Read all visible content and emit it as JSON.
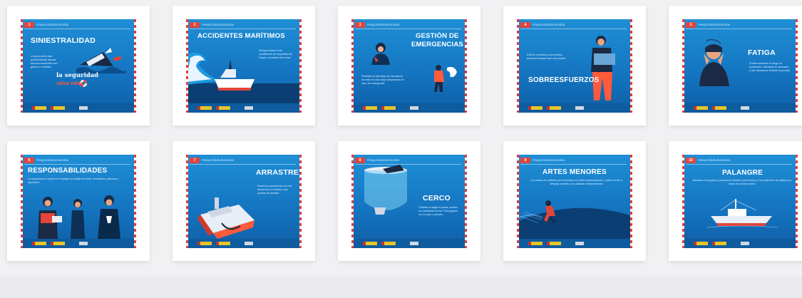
{
  "hashtag": "#seguridadsalvavidas",
  "colors": {
    "card_blue": "#1576c2",
    "badge_red": "#e2463b",
    "accent_orange": "#ff5a3a"
  },
  "cards": [
    {
      "number": "1",
      "title": "SINIESTRALIDAD",
      "description": "Lo pesca tiene alta accidentalidad laboral. Muchos accidentes son graves o mortales.",
      "extra_line1": "la seguridad",
      "extra_line2": "salva vidas"
    },
    {
      "number": "2",
      "title": "ACCIDENTES MARÍTIMOS",
      "description": "Siempre atento a las condiciones de seguridad del buque y al estado de la mar."
    },
    {
      "number": "3",
      "title_line1": "GESTIÓN DE",
      "title_line2": "EMERGENCIAS",
      "description": "Participa en ejercicios de simulacros sin éxito es una mejor preparación en caso de emergencia."
    },
    {
      "number": "4",
      "title": "SOBREESFUERZOS",
      "description": "Evita la maniobra y sus medios anclados siempre que sea posible."
    },
    {
      "number": "5",
      "title": "FATIGA",
      "description": "Puede aumentar el riesgo de accidentes. Descansa lo necesario y haz descansos durante la jornada."
    },
    {
      "number": "6",
      "title": "RESPONSABILIDADES",
      "description": "La seguridad y la salud en el trabajo es trabajo de todos: armadores, patrones y tripulación."
    },
    {
      "number": "7",
      "title": "ARRASTRE",
      "description": "Extrema la precaución con los elementos en tensión y las puertas de arrastre."
    },
    {
      "number": "8",
      "title": "CERCO",
      "description": "Cuidado al largar la jareta: puedes ser arrastrado al mar. Evita golpes con el copo o pancho."
    },
    {
      "number": "9",
      "title": "ARTES MENORES",
      "description": "Los cables en cubierta son frecuentes en estas embarcaciones. Cuida el orden y despeja a bordo y sus caladas embarcaciones."
    },
    {
      "number": "10",
      "title": "PALANGRE",
      "description": "Atención a los golpes y pinchazos durante el perneo/la y a la proyección de objetos por rotura de la línea madre."
    }
  ]
}
